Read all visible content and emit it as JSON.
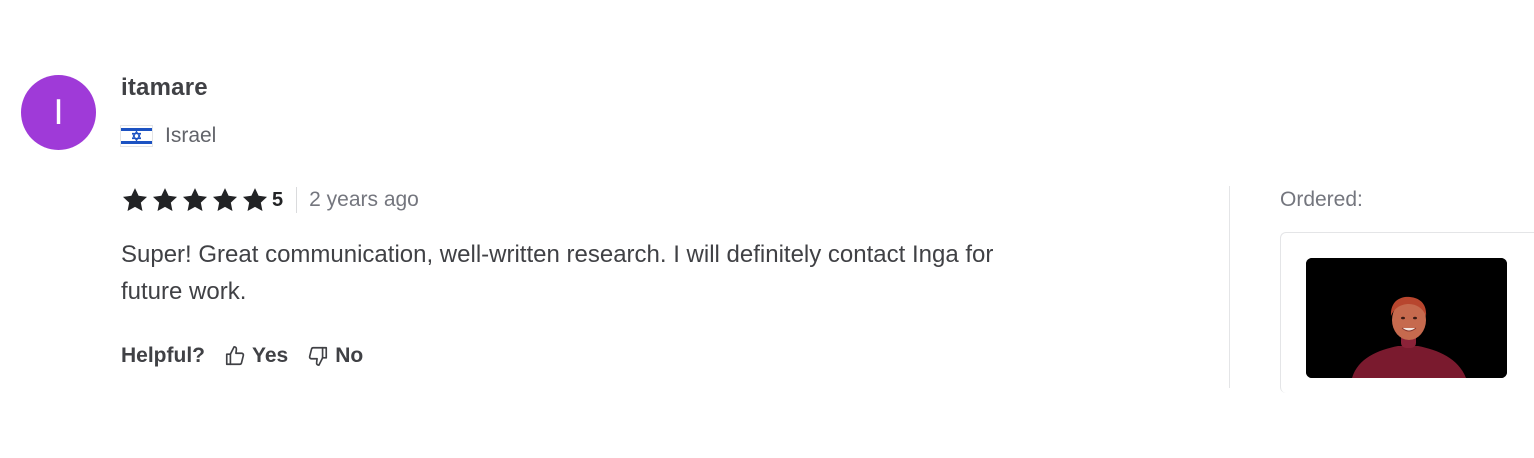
{
  "reviewer": {
    "initial": "I",
    "name": "itamare",
    "country": "Israel",
    "avatar_color": "#9f3ad8",
    "flag_icon": "israel-flag-icon"
  },
  "review": {
    "rating": 5,
    "rating_label": "5",
    "time_ago": "2 years ago",
    "text": "Super! Great communication, well-written research. I will definitely contact Inga for future work.",
    "star_color": "#222325"
  },
  "helpful": {
    "label": "Helpful?",
    "yes_label": "Yes",
    "no_label": "No"
  },
  "ordered": {
    "label": "Ordered:"
  }
}
